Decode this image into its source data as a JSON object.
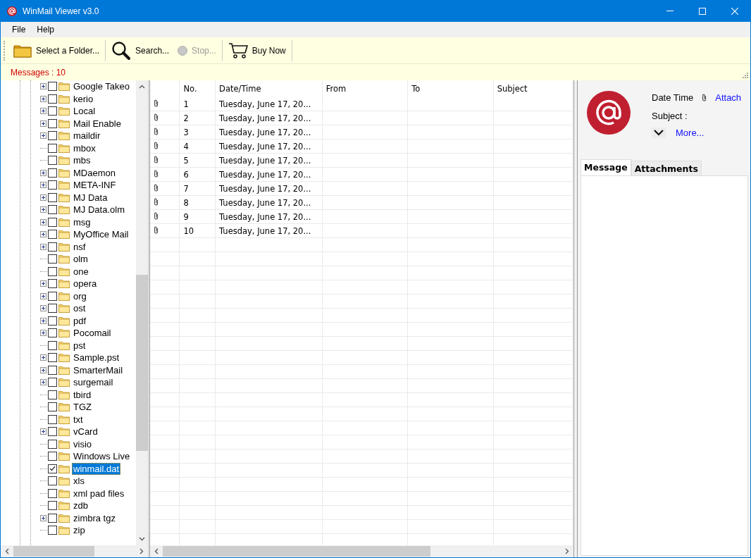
{
  "window": {
    "title": "WinMail Viewer v3.0"
  },
  "menu": [
    {
      "label": "File"
    },
    {
      "label": "Help"
    }
  ],
  "toolbar": [
    {
      "kind": "folder",
      "label": "Select a Folder...",
      "disabled": false
    },
    {
      "kind": "search",
      "label": "Search...",
      "disabled": false
    },
    {
      "kind": "stop",
      "label": "Stop...",
      "disabled": true
    },
    {
      "kind": "cart",
      "label": "Buy Now",
      "disabled": false
    }
  ],
  "status": {
    "messages": "Messages : 10"
  },
  "tree": {
    "items": [
      {
        "label": "Google Takeo",
        "expandable": true,
        "checked": false,
        "selected": false
      },
      {
        "label": "kerio",
        "expandable": true,
        "checked": false,
        "selected": false
      },
      {
        "label": "Local",
        "expandable": true,
        "checked": false,
        "selected": false
      },
      {
        "label": "Mail Enable",
        "expandable": true,
        "checked": false,
        "selected": false
      },
      {
        "label": "maildir",
        "expandable": true,
        "checked": false,
        "selected": false
      },
      {
        "label": "mbox",
        "expandable": false,
        "checked": false,
        "selected": false
      },
      {
        "label": "mbs",
        "expandable": false,
        "checked": false,
        "selected": false
      },
      {
        "label": "MDaemon",
        "expandable": true,
        "checked": false,
        "selected": false
      },
      {
        "label": "META-INF",
        "expandable": true,
        "checked": false,
        "selected": false
      },
      {
        "label": "MJ Data",
        "expandable": true,
        "checked": false,
        "selected": false
      },
      {
        "label": "MJ Data.olm",
        "expandable": true,
        "checked": false,
        "selected": false
      },
      {
        "label": "msg",
        "expandable": true,
        "checked": false,
        "selected": false
      },
      {
        "label": "MyOffice Mail",
        "expandable": true,
        "checked": false,
        "selected": false
      },
      {
        "label": "nsf",
        "expandable": true,
        "checked": false,
        "selected": false
      },
      {
        "label": "olm",
        "expandable": false,
        "checked": false,
        "selected": false
      },
      {
        "label": "one",
        "expandable": false,
        "checked": false,
        "selected": false
      },
      {
        "label": "opera",
        "expandable": true,
        "checked": false,
        "selected": false
      },
      {
        "label": "org",
        "expandable": true,
        "checked": false,
        "selected": false
      },
      {
        "label": "ost",
        "expandable": true,
        "checked": false,
        "selected": false
      },
      {
        "label": "pdf",
        "expandable": true,
        "checked": false,
        "selected": false
      },
      {
        "label": "Pocomail",
        "expandable": true,
        "checked": false,
        "selected": false
      },
      {
        "label": "pst",
        "expandable": false,
        "checked": false,
        "selected": false
      },
      {
        "label": "Sample.pst",
        "expandable": true,
        "checked": false,
        "selected": false
      },
      {
        "label": "SmarterMail",
        "expandable": true,
        "checked": false,
        "selected": false
      },
      {
        "label": "surgemail",
        "expandable": true,
        "checked": false,
        "selected": false
      },
      {
        "label": "tbird",
        "expandable": false,
        "checked": false,
        "selected": false
      },
      {
        "label": "TGZ",
        "expandable": false,
        "checked": false,
        "selected": false
      },
      {
        "label": "txt",
        "expandable": false,
        "checked": false,
        "selected": false
      },
      {
        "label": "vCard",
        "expandable": true,
        "checked": false,
        "selected": false
      },
      {
        "label": "visio",
        "expandable": false,
        "checked": false,
        "selected": false
      },
      {
        "label": "Windows Live",
        "expandable": false,
        "checked": false,
        "selected": false
      },
      {
        "label": "winmail.dat",
        "expandable": false,
        "checked": true,
        "selected": true
      },
      {
        "label": "xls",
        "expandable": false,
        "checked": false,
        "selected": false
      },
      {
        "label": "xml pad files",
        "expandable": false,
        "checked": false,
        "selected": false
      },
      {
        "label": "zdb",
        "expandable": false,
        "checked": false,
        "selected": false
      },
      {
        "label": "zimbra tgz",
        "expandable": true,
        "checked": false,
        "selected": false
      },
      {
        "label": "zip",
        "expandable": false,
        "checked": false,
        "selected": false
      }
    ]
  },
  "table": {
    "columns": [
      "No.",
      "Date/Time",
      "From",
      "To",
      "Subject"
    ],
    "rows": [
      {
        "no": "1",
        "date": "Tuesday, June 17, 20...",
        "attachment": true
      },
      {
        "no": "2",
        "date": "Tuesday, June 17, 20...",
        "attachment": true
      },
      {
        "no": "3",
        "date": "Tuesday, June 17, 20...",
        "attachment": true
      },
      {
        "no": "4",
        "date": "Tuesday, June 17, 20...",
        "attachment": true
      },
      {
        "no": "5",
        "date": "Tuesday, June 17, 20...",
        "attachment": true
      },
      {
        "no": "6",
        "date": "Tuesday, June 17, 20...",
        "attachment": true
      },
      {
        "no": "7",
        "date": "Tuesday, June 17, 20...",
        "attachment": true
      },
      {
        "no": "8",
        "date": "Tuesday, June 17, 20...",
        "attachment": true
      },
      {
        "no": "9",
        "date": "Tuesday, June 17, 20...",
        "attachment": true
      },
      {
        "no": "10",
        "date": "Tuesday, June 17, 20...",
        "attachment": true
      }
    ]
  },
  "preview": {
    "date_label": "Date Time",
    "attach_link": "Attach",
    "subject_label": "Subject :",
    "more_link": "More...",
    "tabs": [
      {
        "label": "Message",
        "selected": true
      },
      {
        "label": "Attachments",
        "selected": false
      }
    ]
  }
}
